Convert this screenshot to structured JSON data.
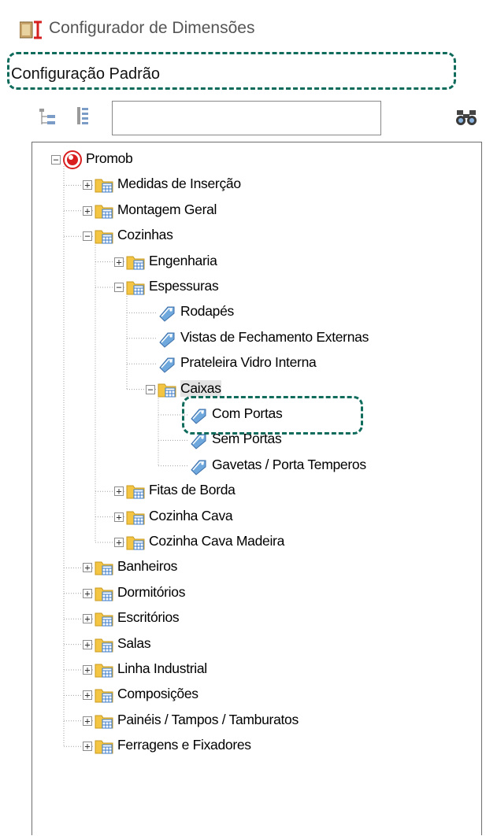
{
  "window": {
    "title": "Configurador de Dimensões",
    "config_name": "Configuração Padrão"
  },
  "toolbar": {
    "collapse_icon": "tree-collapse-icon",
    "expand_icon": "tree-expand-icon",
    "search_value": "",
    "find_icon": "binoculars-icon"
  },
  "colors": {
    "highlight": "#0f6b5c",
    "folder": "#f4c542",
    "root_icon": "#d81e1e",
    "tag": "#6fa8dc"
  },
  "tree": [
    {
      "label": "Promob",
      "icon": "root",
      "level": 0,
      "expander": "minus"
    },
    {
      "label": "Medidas de Inserção",
      "icon": "folder",
      "level": 1,
      "expander": "plus"
    },
    {
      "label": "Montagem Geral",
      "icon": "folder",
      "level": 1,
      "expander": "plus"
    },
    {
      "label": "Cozinhas",
      "icon": "folder",
      "level": 1,
      "expander": "minus"
    },
    {
      "label": "Engenharia",
      "icon": "folder",
      "level": 2,
      "expander": "plus"
    },
    {
      "label": "Espessuras",
      "icon": "folder",
      "level": 2,
      "expander": "minus"
    },
    {
      "label": "Rodapés",
      "icon": "tag",
      "level": 3,
      "expander": ""
    },
    {
      "label": "Vistas de Fechamento Externas",
      "icon": "tag",
      "level": 3,
      "expander": ""
    },
    {
      "label": "Prateleira Vidro Interna",
      "icon": "tag",
      "level": 3,
      "expander": ""
    },
    {
      "label": "Caixas",
      "icon": "folder",
      "level": 3,
      "expander": "minus",
      "selected": true
    },
    {
      "label": "Com Portas",
      "icon": "tag",
      "level": 4,
      "expander": ""
    },
    {
      "label": "Sem Portas",
      "icon": "tag",
      "level": 4,
      "expander": ""
    },
    {
      "label": "Gavetas / Porta Temperos",
      "icon": "tag",
      "level": 4,
      "expander": ""
    },
    {
      "label": "Fitas de Borda",
      "icon": "folder",
      "level": 2,
      "expander": "plus"
    },
    {
      "label": "Cozinha Cava",
      "icon": "folder",
      "level": 2,
      "expander": "plus"
    },
    {
      "label": "Cozinha Cava Madeira",
      "icon": "folder",
      "level": 2,
      "expander": "plus"
    },
    {
      "label": "Banheiros",
      "icon": "folder",
      "level": 1,
      "expander": "plus"
    },
    {
      "label": "Dormitórios",
      "icon": "folder",
      "level": 1,
      "expander": "plus"
    },
    {
      "label": "Escritórios",
      "icon": "folder",
      "level": 1,
      "expander": "plus"
    },
    {
      "label": "Salas",
      "icon": "folder",
      "level": 1,
      "expander": "plus"
    },
    {
      "label": "Linha Industrial",
      "icon": "folder",
      "level": 1,
      "expander": "plus"
    },
    {
      "label": "Composições",
      "icon": "folder",
      "level": 1,
      "expander": "plus"
    },
    {
      "label": "Painéis / Tampos / Tamburatos",
      "icon": "folder",
      "level": 1,
      "expander": "plus"
    },
    {
      "label": "Ferragens e Fixadores",
      "icon": "folder",
      "level": 1,
      "expander": "plus"
    }
  ]
}
